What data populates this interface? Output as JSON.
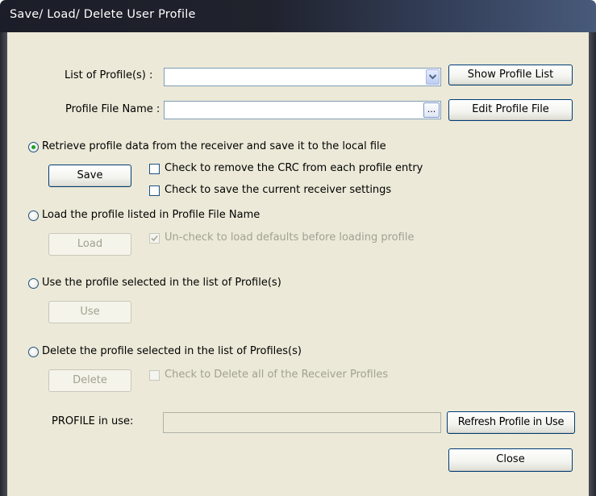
{
  "window": {
    "title": "Save/ Load/ Delete User Profile"
  },
  "profiles": {
    "list_label": "List of Profile(s) :",
    "list_value": "",
    "show_button": "Show Profile List",
    "file_label": "Profile File Name :",
    "file_value": "",
    "browse_button": "...",
    "edit_button": "Edit Profile File"
  },
  "options": {
    "retrieve": {
      "label": "Retrieve profile data from the receiver and save it to the local file",
      "selected": true,
      "button": "Save",
      "check_crc": "Check to remove the CRC from each profile entry",
      "check_settings": "Check to save the current receiver settings"
    },
    "load": {
      "label": "Load the profile listed in Profile File Name",
      "selected": false,
      "button": "Load",
      "check_defaults": "Un-check to load defaults before loading profile"
    },
    "use": {
      "label": "Use the profile selected in the list of Profile(s)",
      "selected": false,
      "button": "Use"
    },
    "delete": {
      "label": "Delete the profile selected in the list of Profiles(s)",
      "selected": false,
      "button": "Delete",
      "check_all": "Check to Delete all of the Receiver Profiles"
    }
  },
  "footer": {
    "in_use_label": "PROFILE in use:",
    "in_use_value": "",
    "refresh_button": "Refresh Profile in Use",
    "close_button": "Close"
  },
  "colors": {
    "accent_radio": "#21a121",
    "dialog_bg": "#ece9d8",
    "button_border": "#003c74"
  }
}
